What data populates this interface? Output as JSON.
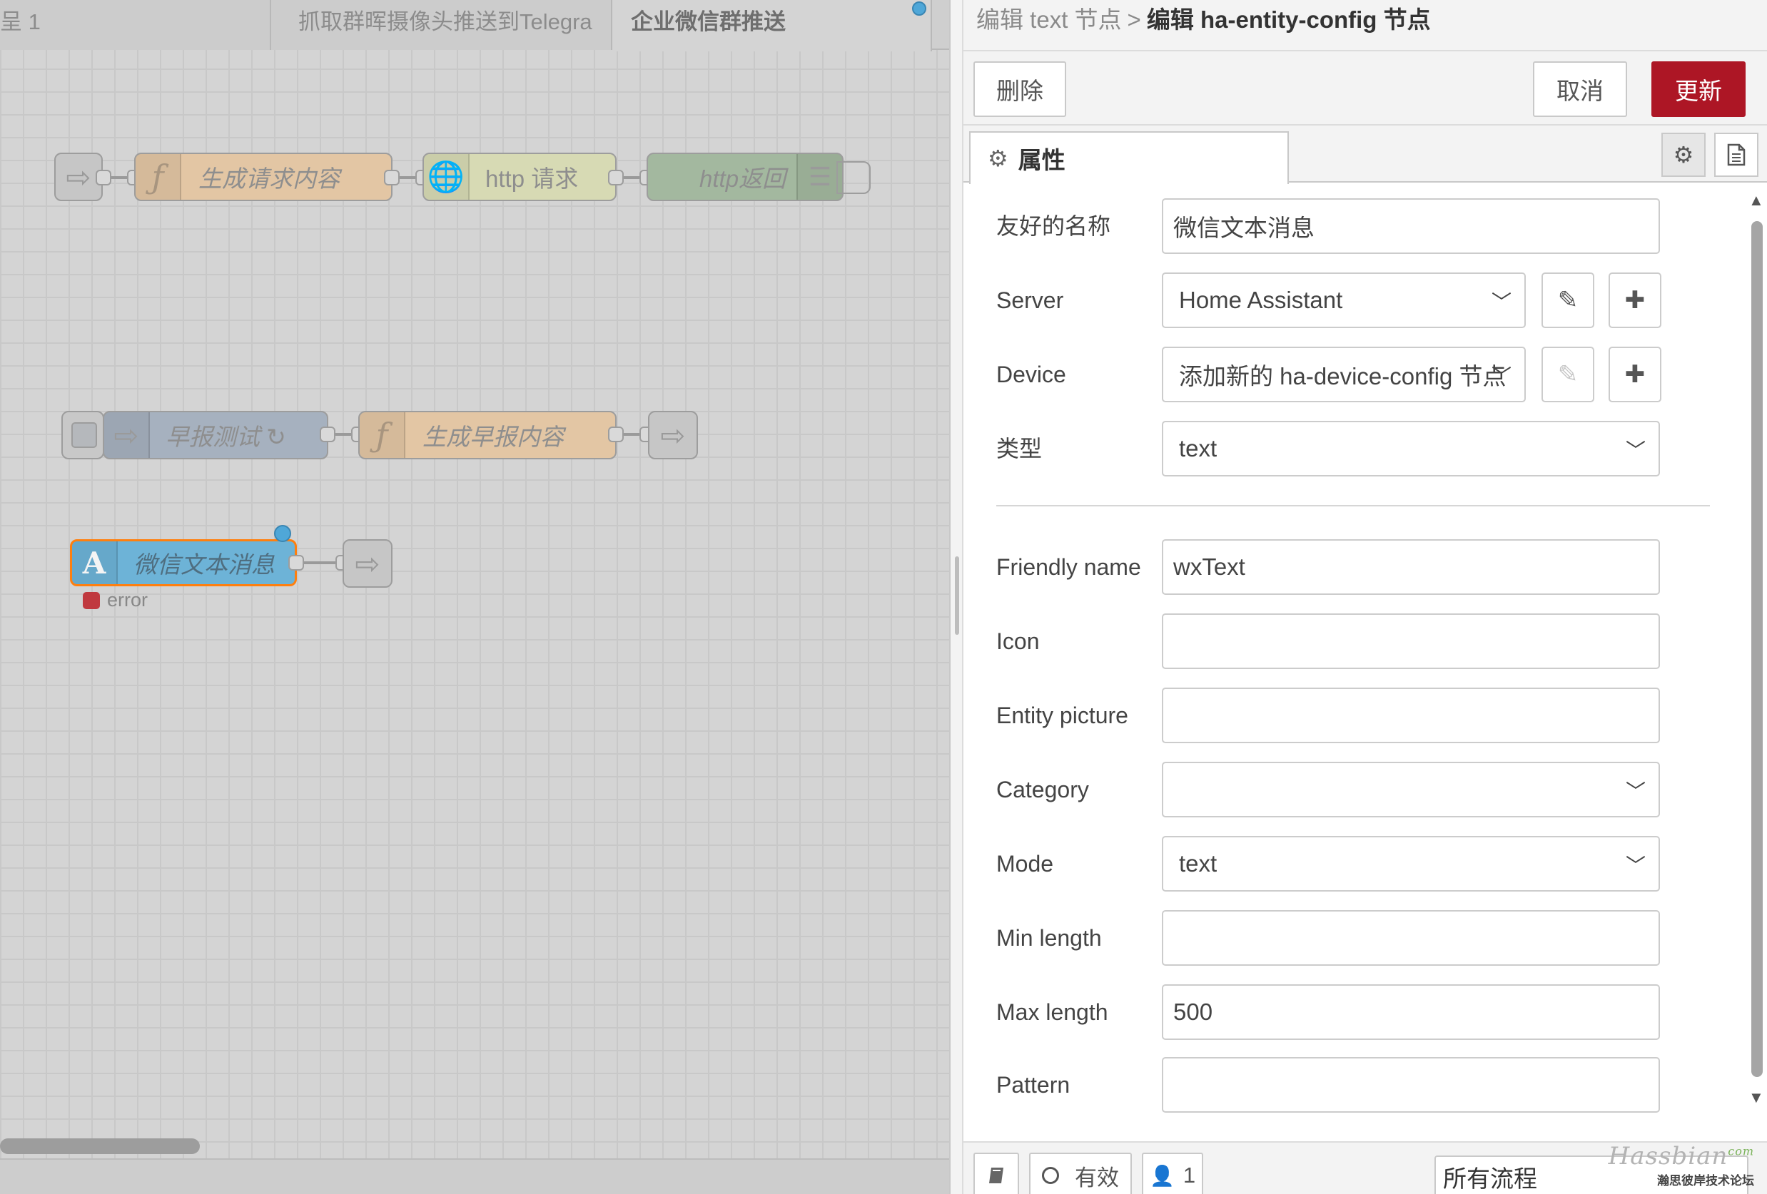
{
  "workspace": {
    "tabs": [
      {
        "label": "呈 1"
      },
      {
        "label": "抓取群晖摄像头推送到Telegra"
      },
      {
        "label": "企业微信群推送"
      }
    ],
    "nodes": {
      "gen_request": "生成请求内容",
      "http_request": "http 请求",
      "http_response": "http返回",
      "morning_test": "早报测试 ↻",
      "gen_morning": "生成早报内容",
      "wx_text": "微信文本消息",
      "wx_status": "error"
    },
    "colors": {
      "function_node": "#e8c8a6",
      "http_node": "#d7dcb3",
      "http_response_node": "#9fb89c",
      "inject_node": "#a2afbd",
      "text_node": "#6ab2d6",
      "selected_border": "#ff7f0e",
      "error_status": "#c0393f"
    }
  },
  "tray": {
    "breadcrumb": {
      "parent": "编辑 text 节点",
      "separator": ">",
      "current": "编辑 ha-entity-config 节点"
    },
    "toolbar": {
      "delete_label": "删除",
      "cancel_label": "取消",
      "update_label": "更新"
    },
    "tabs": {
      "properties_label": "属性",
      "settings_icon": "gear-icon",
      "description_icon": "document-icon"
    },
    "form": {
      "friendly_name_zh": {
        "label": "友好的名称",
        "value": "微信文本消息"
      },
      "server": {
        "label": "Server",
        "value": "Home Assistant"
      },
      "device": {
        "label": "Device",
        "value": "添加新的 ha-device-config 节点"
      },
      "type": {
        "label": "类型",
        "value": "text"
      },
      "friendly_name": {
        "label": "Friendly name",
        "value": "wxText"
      },
      "icon": {
        "label": "Icon",
        "value": ""
      },
      "entity_picture": {
        "label": "Entity picture",
        "value": ""
      },
      "category": {
        "label": "Category",
        "value": ""
      },
      "mode": {
        "label": "Mode",
        "value": "text"
      },
      "min_length": {
        "label": "Min length",
        "value": ""
      },
      "max_length": {
        "label": "Max length",
        "value": "500"
      },
      "pattern": {
        "label": "Pattern",
        "value": ""
      }
    },
    "footer": {
      "enabled_label": "有效",
      "users_count": "1",
      "flow_scope": "所有流程"
    },
    "colors": {
      "primary_button": "#ad1625"
    }
  },
  "watermark": {
    "brand": "Hassbian",
    "domain": "com",
    "tagline": "瀚思彼岸技术论坛"
  }
}
